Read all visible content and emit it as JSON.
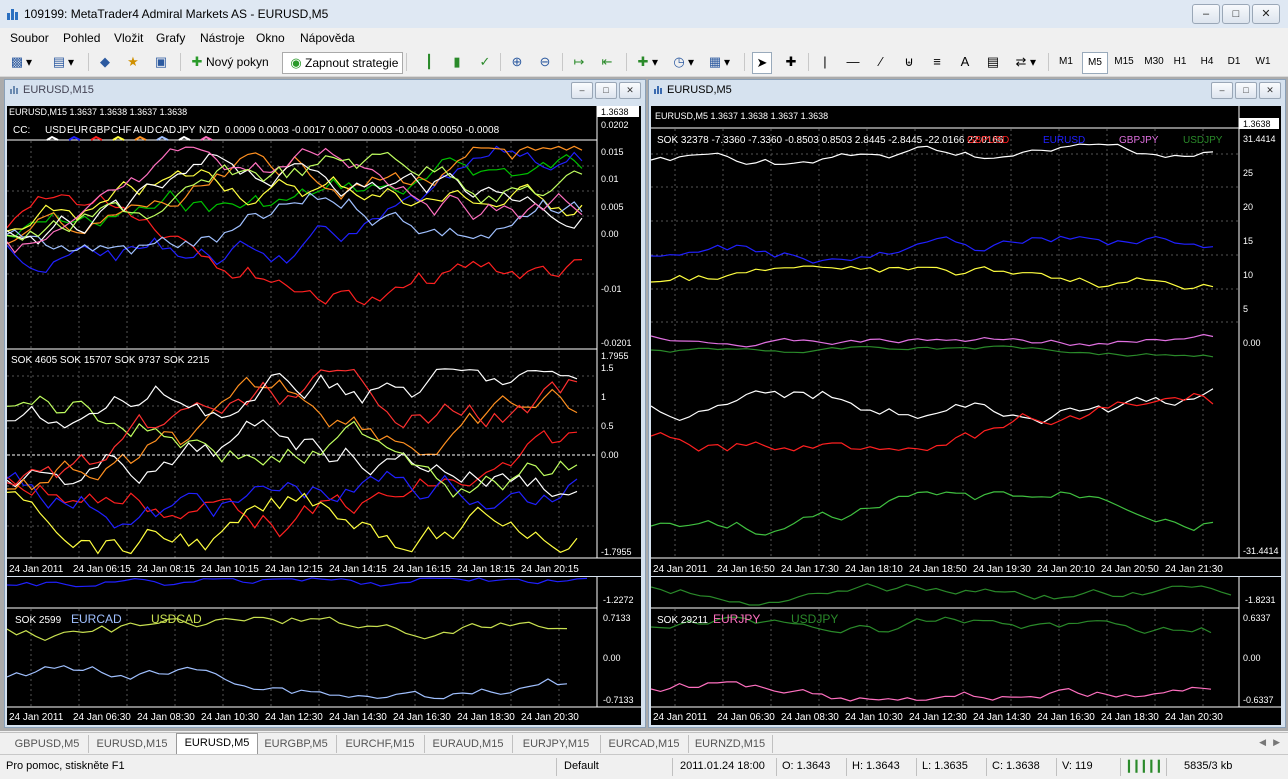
{
  "window": {
    "title": "109199: MetaTrader4 Admiral Markets AS - EURUSD,M5"
  },
  "menu": [
    "Soubor",
    "Pohled",
    "Vložit",
    "Grafy",
    "Nástroje",
    "Okno",
    "Nápověda"
  ],
  "toolbar": {
    "new_order": "Nový pokyn",
    "strategy": "Zapnout strategie"
  },
  "timeframes": [
    "M1",
    "M5",
    "M15",
    "M30",
    "H1",
    "H4",
    "D1",
    "W1"
  ],
  "timeframe_active": "M5",
  "windows": {
    "left": {
      "title": "EURUSD,M15",
      "info": "EURUSD,M15  1.3637 1.3638 1.3637 1.3638",
      "price": "1.3638",
      "cc_label": "CC:",
      "cc_currencies": [
        "USD",
        "EUR",
        "GBP",
        "CHF",
        "AUD",
        "CAD",
        "JPY",
        "NZD"
      ],
      "cc_values": "0.0009 0.0003 -0.0017 0.0007 0.0003 -0.0048 0.0050 -0.0008",
      "cc_axis": [
        "0.0202",
        "0.015",
        "0.01",
        "0.005",
        "0.00",
        "-0.01",
        "-0.0201"
      ],
      "sok_label": "SOK 4605  SOK 15707  SOK 9737  SOK 2215",
      "sok_axis": [
        "1.7955",
        "1.5",
        "1",
        "0.5",
        "0.00",
        "-1.7955"
      ],
      "sok_mid": "0.00",
      "time_axis": [
        "24 Jan 2011",
        "24 Jan 06:15",
        "24 Jan 08:15",
        "24 Jan 10:15",
        "24 Jan 12:15",
        "24 Jan 14:15",
        "24 Jan 16:15",
        "24 Jan 18:15",
        "24 Jan 20:15"
      ]
    },
    "right": {
      "title": "EURUSD,M5",
      "info": "EURUSD,M5  1.3637 1.3638 1.3637 1.3638",
      "price": "1.3638",
      "sok_label": "SOK 32378 -7.3360 -7.3360 -0.8503 0.8503 2.8445 -2.8445 -22.0166 22.0166",
      "legend": [
        {
          "name": "GBPUSD",
          "color": "#ff2020"
        },
        {
          "name": "EURUSD",
          "color": "#2020ff"
        },
        {
          "name": "GBPJPY",
          "color": "#e070e0"
        },
        {
          "name": "USDJPY",
          "color": "#2a8a2a"
        }
      ],
      "axis": [
        "31.4414",
        "25",
        "20",
        "15",
        "10",
        "5",
        "0.00",
        "-31.4414"
      ],
      "time_axis": [
        "24 Jan 2011",
        "24 Jan 16:50",
        "24 Jan 17:30",
        "24 Jan 18:10",
        "24 Jan 18:50",
        "24 Jan 19:30",
        "24 Jan 20:10",
        "24 Jan 20:50",
        "24 Jan 21:30"
      ]
    },
    "bottom_left": {
      "top_value": "-1.2272",
      "sok_label": "SOK 2599",
      "legend": [
        {
          "name": "EURCAD",
          "color": "#a0c0ff"
        },
        {
          "name": "USDCAD",
          "color": "#c8e050"
        }
      ],
      "axis": [
        "0.7133",
        "0.00",
        "-0.7133"
      ],
      "time_axis": [
        "24 Jan 2011",
        "24 Jan 06:30",
        "24 Jan 08:30",
        "24 Jan 10:30",
        "24 Jan 12:30",
        "24 Jan 14:30",
        "24 Jan 16:30",
        "24 Jan 18:30",
        "24 Jan 20:30"
      ]
    },
    "bottom_right": {
      "top_value": "-1.8231",
      "sok_label": "SOK 29211",
      "legend": [
        {
          "name": "EURJPY",
          "color": "#ff70c0"
        },
        {
          "name": "USDJPY",
          "color": "#2a8a2a"
        }
      ],
      "axis": [
        "0.6337",
        "0.00",
        "-0.6337"
      ],
      "time_axis": [
        "24 Jan 2011",
        "24 Jan 06:30",
        "24 Jan 08:30",
        "24 Jan 10:30",
        "24 Jan 12:30",
        "24 Jan 14:30",
        "24 Jan 16:30",
        "24 Jan 18:30",
        "24 Jan 20:30"
      ]
    }
  },
  "tabs": [
    "GBPUSD,M5",
    "EURUSD,M15",
    "EURUSD,M5",
    "EURGBP,M5",
    "EURCHF,M15",
    "EURAUD,M15",
    "EURJPY,M15",
    "EURCAD,M15",
    "EURNZD,M15"
  ],
  "tab_active": "EURUSD,M5",
  "status": {
    "help": "Pro pomoc, stiskněte F1",
    "profile": "Default",
    "datetime": "2011.01.24 18:00",
    "open": "O: 1.3643",
    "high": "H: 1.3643",
    "low": "L: 1.3635",
    "close": "C: 1.3638",
    "volume": "V: 119",
    "traffic": "5835/3 kb"
  }
}
